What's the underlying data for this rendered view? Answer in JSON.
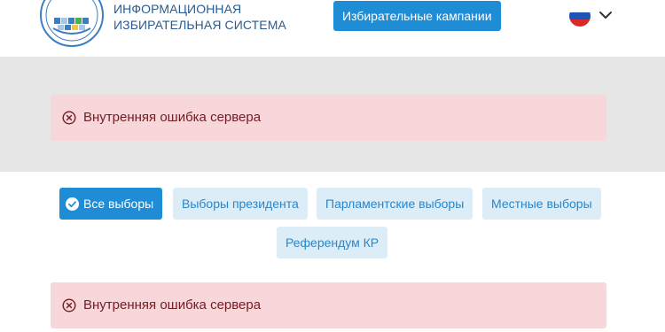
{
  "header": {
    "brand_line1": "ИНФОРМАЦИОННАЯ",
    "brand_line2": "ИЗБИРАТЕЛЬНАЯ СИСТЕМА",
    "campaigns_label": "Избирательные кампании",
    "language_flag": "russia-flag",
    "language_chevron_icon": "chevron-down-icon"
  },
  "alerts": {
    "top_message": "Внутренняя ошибка сервера",
    "bottom_message": "Внутренняя ошибка сервера",
    "icon": "circle-x-icon"
  },
  "filters": {
    "all": "Все выборы",
    "president": "Выборы президента",
    "parliament": "Парламентские выборы",
    "local": "Местные выборы",
    "referendum": "Референдум КР",
    "active": "all"
  },
  "colors": {
    "primary": "#1f8dd6",
    "brand_text": "#2a5c8f",
    "alert_bg": "#f8d7da",
    "alert_text": "#721c24",
    "filter_inactive_bg": "#dcedf8",
    "band_gray": "#e6e6e6"
  }
}
